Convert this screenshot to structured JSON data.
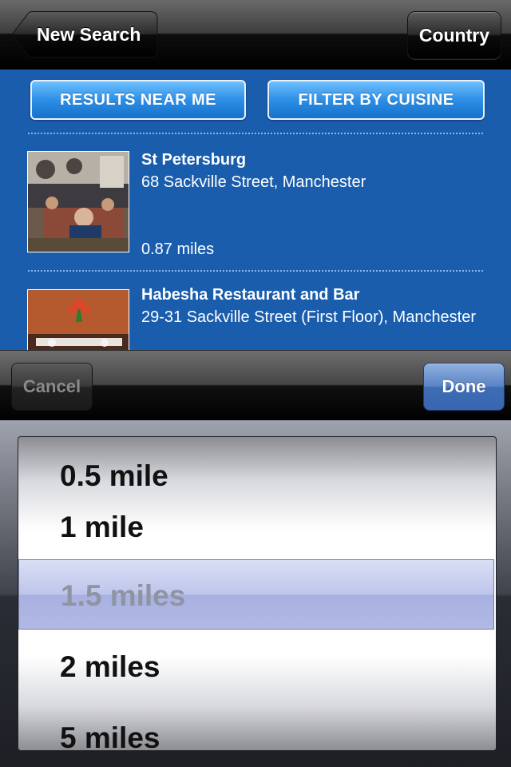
{
  "nav": {
    "back_label": "New Search",
    "country_label": "Country"
  },
  "filters": {
    "near_me": "RESULTS NEAR ME",
    "cuisine": "FILTER BY CUISINE"
  },
  "results": [
    {
      "name": "St Petersburg",
      "address": "68 Sackville Street, Manchester",
      "distance": "0.87 miles"
    },
    {
      "name": "Habesha Restaurant and Bar",
      "address": "29-31 Sackville Street (First Floor), Manchester"
    }
  ],
  "toolbar": {
    "cancel_label": "Cancel",
    "done_label": "Done"
  },
  "picker": {
    "options": [
      "0.5 mile",
      "1 mile",
      "1.5 miles",
      "2 miles",
      "5 miles"
    ],
    "selected": "1.5 miles"
  },
  "colors": {
    "content_blue": "#1a5dad",
    "done_blue": "#3e6db4"
  }
}
